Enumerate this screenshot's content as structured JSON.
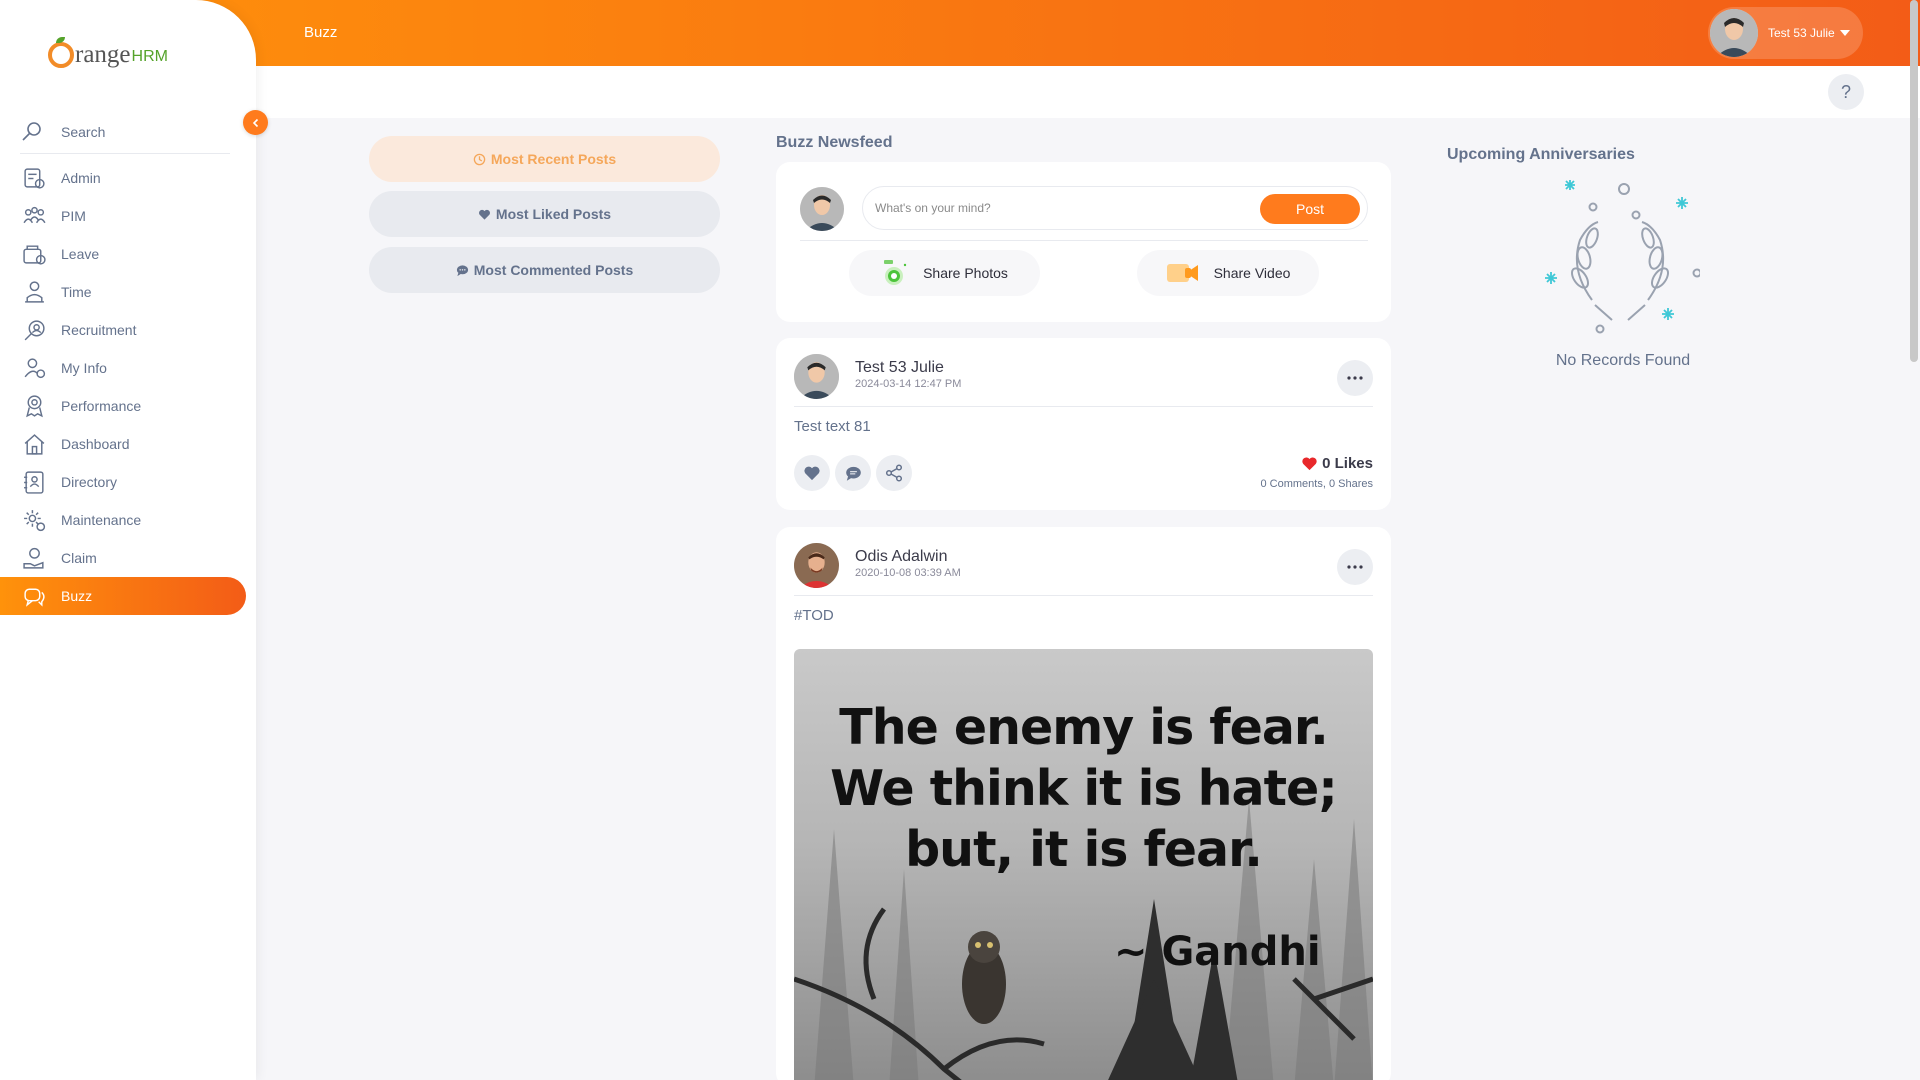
{
  "topbar": {
    "page_title": "Buzz",
    "user_name": "Test 53 Julie"
  },
  "brand": {
    "logo_text": "range",
    "logo_suffix": "HRM"
  },
  "sidebar": {
    "search_placeholder": "Search",
    "items": [
      {
        "label": "Admin",
        "icon": "admin-icon"
      },
      {
        "label": "PIM",
        "icon": "pim-icon"
      },
      {
        "label": "Leave",
        "icon": "leave-icon"
      },
      {
        "label": "Time",
        "icon": "time-icon"
      },
      {
        "label": "Recruitment",
        "icon": "recruitment-icon"
      },
      {
        "label": "My Info",
        "icon": "my-info-icon"
      },
      {
        "label": "Performance",
        "icon": "performance-icon"
      },
      {
        "label": "Dashboard",
        "icon": "dashboard-icon"
      },
      {
        "label": "Directory",
        "icon": "directory-icon"
      },
      {
        "label": "Maintenance",
        "icon": "maintenance-icon"
      },
      {
        "label": "Claim",
        "icon": "claim-icon"
      },
      {
        "label": "Buzz",
        "icon": "buzz-icon",
        "active": true
      }
    ]
  },
  "help_label": "?",
  "filters": [
    {
      "label": "Most Recent Posts",
      "icon": "clock-icon",
      "active": true
    },
    {
      "label": "Most Liked Posts",
      "icon": "heart-icon",
      "active": false
    },
    {
      "label": "Most Commented Posts",
      "icon": "comment-icon",
      "active": false
    }
  ],
  "newsfeed": {
    "title": "Buzz Newsfeed",
    "composer": {
      "placeholder": "What's on your mind?",
      "post_label": "Post",
      "share_photos_label": "Share Photos",
      "share_video_label": "Share Video"
    },
    "posts": [
      {
        "author": "Test 53 Julie",
        "date": "2024-03-14 12:47 PM",
        "text": "Test text 81",
        "likes": "0 Likes",
        "comments": "0 Comments",
        "shares": "0 Shares"
      },
      {
        "author": "Odis Adalwin",
        "date": "2020-10-08 03:39 AM",
        "text": "#TOD",
        "image_quote": "The enemy is fear. We think it is hate; but, it is fear.",
        "image_quote_lines": [
          "The enemy is fear.",
          "We think it is hate;",
          "but, it is fear."
        ],
        "image_attribution": "~ Gandhi"
      }
    ]
  },
  "anniversaries": {
    "title": "Upcoming Anniversaries",
    "empty_text": "No Records Found"
  },
  "colors": {
    "brand_orange": "#ff7b1d",
    "gradient_start": "#ff920b",
    "gradient_end": "#f35c17",
    "text": "#64728c"
  }
}
